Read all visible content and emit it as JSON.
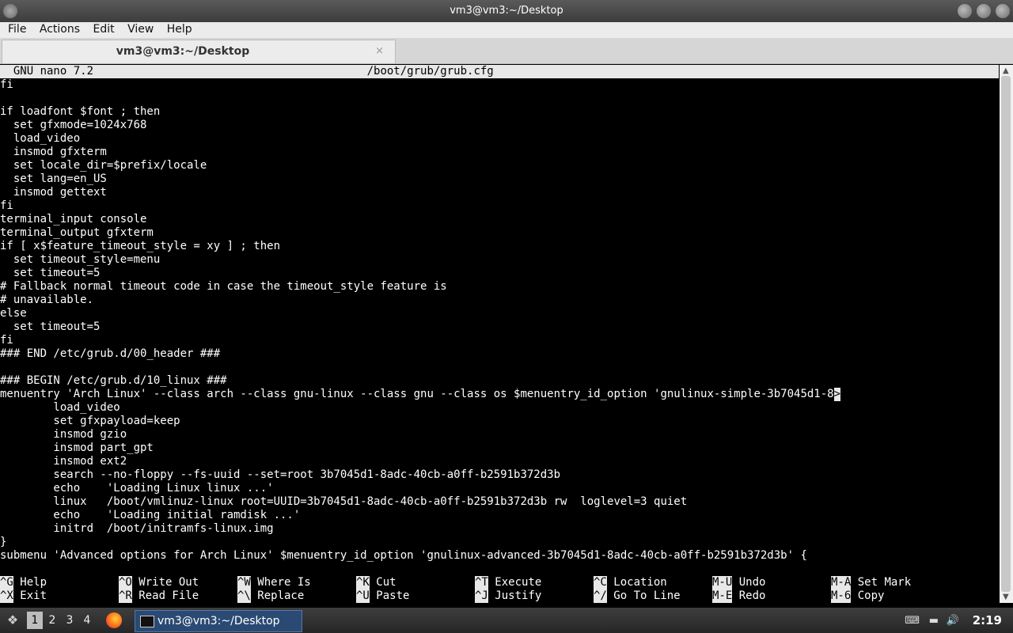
{
  "window": {
    "title": "vm3@vm3:~/Desktop"
  },
  "menu": [
    "File",
    "Actions",
    "Edit",
    "View",
    "Help"
  ],
  "tab": {
    "label": "vm3@vm3:~/Desktop",
    "close": "×"
  },
  "nano": {
    "version": "  GNU nano 7.2",
    "file": "/boot/grub/grub.cfg",
    "lines": [
      "fi",
      "",
      "if loadfont $font ; then",
      "  set gfxmode=1024x768",
      "  load_video",
      "  insmod gfxterm",
      "  set locale_dir=$prefix/locale",
      "  set lang=en_US",
      "  insmod gettext",
      "fi",
      "terminal_input console",
      "terminal_output gfxterm",
      "if [ x$feature_timeout_style = xy ] ; then",
      "  set timeout_style=menu",
      "  set timeout=5",
      "# Fallback normal timeout code in case the timeout_style feature is",
      "# unavailable.",
      "else",
      "  set timeout=5",
      "fi",
      "### END /etc/grub.d/00_header ###",
      "",
      "### BEGIN /etc/grub.d/10_linux ###",
      "menuentry 'Arch Linux' --class arch --class gnu-linux --class gnu --class os $menuentry_id_option 'gnulinux-simple-3b7045d1-8",
      "        load_video",
      "        set gfxpayload=keep",
      "        insmod gzio",
      "        insmod part_gpt",
      "        insmod ext2",
      "        search --no-floppy --fs-uuid --set=root 3b7045d1-8adc-40cb-a0ff-b2591b372d3b",
      "        echo    'Loading Linux linux ...'",
      "        linux   /boot/vmlinuz-linux root=UUID=3b7045d1-8adc-40cb-a0ff-b2591b372d3b rw  loglevel=3 quiet",
      "        echo    'Loading initial ramdisk ...'",
      "        initrd  /boot/initramfs-linux.img",
      "}",
      "submenu 'Advanced options for Arch Linux' $menuentry_id_option 'gnulinux-advanced-3b7045d1-8adc-40cb-a0ff-b2591b372d3b' {"
    ],
    "shortcuts_row1": [
      {
        "key": "^G",
        "label": "Help"
      },
      {
        "key": "^O",
        "label": "Write Out"
      },
      {
        "key": "^W",
        "label": "Where Is"
      },
      {
        "key": "^K",
        "label": "Cut"
      },
      {
        "key": "^T",
        "label": "Execute"
      },
      {
        "key": "^C",
        "label": "Location"
      },
      {
        "key": "M-U",
        "label": "Undo"
      },
      {
        "key": "M-A",
        "label": "Set Mark"
      }
    ],
    "shortcuts_row2": [
      {
        "key": "^X",
        "label": "Exit"
      },
      {
        "key": "^R",
        "label": "Read File"
      },
      {
        "key": "^\\",
        "label": "Replace"
      },
      {
        "key": "^U",
        "label": "Paste"
      },
      {
        "key": "^J",
        "label": "Justify"
      },
      {
        "key": "^/",
        "label": "Go To Line"
      },
      {
        "key": "M-E",
        "label": "Redo"
      },
      {
        "key": "M-6",
        "label": "Copy"
      }
    ]
  },
  "taskbar": {
    "workspaces": [
      "1",
      "2",
      "3",
      "4"
    ],
    "active_workspace": "1",
    "task_label": "vm3@vm3:~/Desktop",
    "clock": "2:19"
  }
}
